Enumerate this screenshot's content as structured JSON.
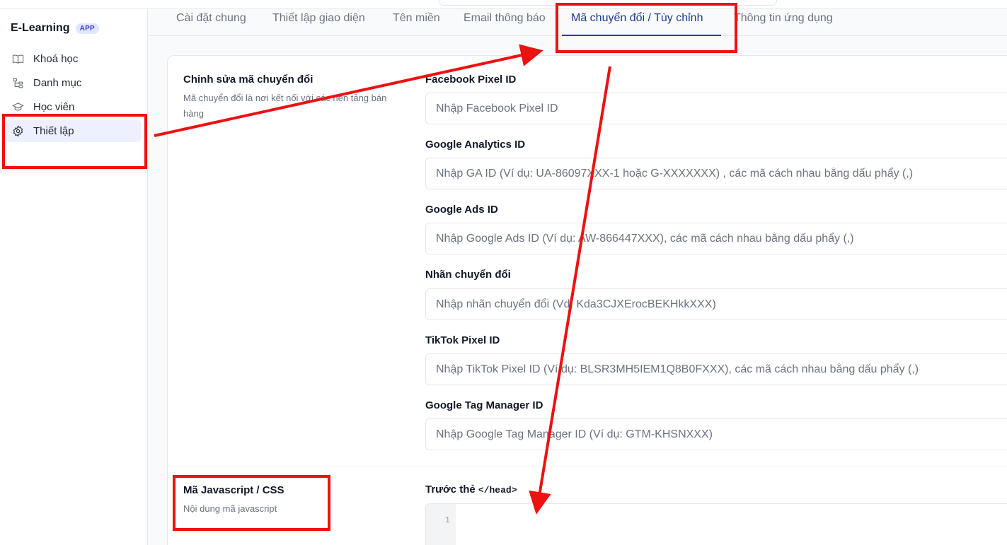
{
  "brand": {
    "name": "E-Learning",
    "badge": "APP"
  },
  "sidebar": {
    "items": [
      {
        "label": "Khoá học",
        "icon": "book-open-icon"
      },
      {
        "label": "Danh mục",
        "icon": "category-tree-icon"
      },
      {
        "label": "Học viên",
        "icon": "graduation-cap-icon"
      },
      {
        "label": "Thiết lập",
        "icon": "gear-icon",
        "active": true
      }
    ]
  },
  "tabs": [
    {
      "label": "Cài đặt chung"
    },
    {
      "label": "Thiết lập giao diện"
    },
    {
      "label": "Tên miền"
    },
    {
      "label": "Email thông báo"
    },
    {
      "label": "Mã chuyển đổi / Tùy chỉnh",
      "active": true
    },
    {
      "label": "Thông tin ứng dụng"
    }
  ],
  "conversion": {
    "title": "Chỉnh sửa mã chuyển đổi",
    "description": "Mã chuyển đổi là nơi kết nối với các nền tảng bán hàng",
    "fields": [
      {
        "label": "Facebook Pixel ID",
        "value": "",
        "placeholder": "Nhập Facebook Pixel ID"
      },
      {
        "label": "Google Analytics ID",
        "value": "",
        "placeholder": "Nhập GA ID (Ví dụ: UA-86097XXX-1 hoặc G-XXXXXXX) , các mã cách nhau bằng dấu phẩy (,)"
      },
      {
        "label": "Google Ads ID",
        "value": "",
        "placeholder": "Nhập Google Ads ID (Ví dụ: AW-866447XXX), các mã cách nhau bằng dấu phẩy (,)"
      },
      {
        "label": "Nhãn chuyển đổi",
        "value": "",
        "placeholder": "Nhập nhãn chuyển đổi (Vd: Kda3CJXErocBEKHkkXXX)"
      },
      {
        "label": "TikTok Pixel ID",
        "value": "",
        "placeholder": "Nhập TikTok Pixel ID (Ví dụ: BLSR3MH5IEM1Q8B0FXXX), các mã cách nhau bằng dấu phẩy (,)"
      },
      {
        "label": "Google Tag Manager ID",
        "value": "",
        "placeholder": "Nhập Google Tag Manager ID (Ví dụ: GTM-KHSNXXX)"
      }
    ]
  },
  "javascript": {
    "title": "Mã Javascript / CSS",
    "description": "Nội dung mã javascript",
    "head_label": "Trước thẻ",
    "head_tag": "</head>",
    "line_number": "1"
  },
  "colors": {
    "accent": "#1e40af",
    "active_nav_bg": "#eef0ff",
    "annotation_red": "#ee1111"
  }
}
